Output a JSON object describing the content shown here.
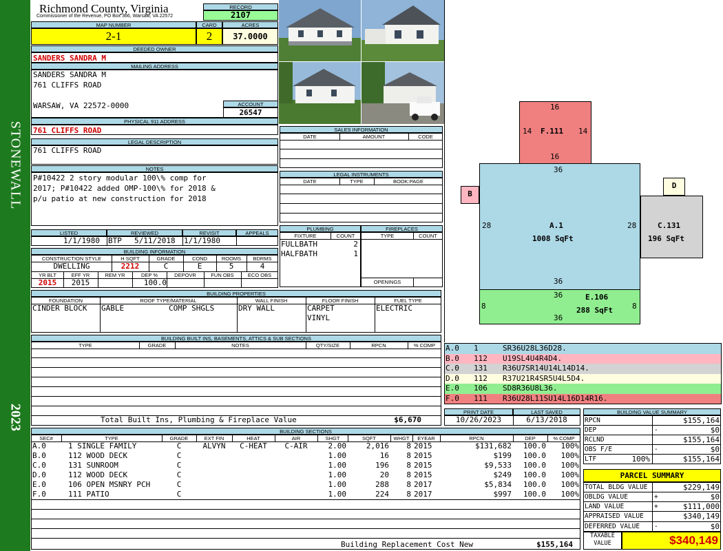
{
  "sidebar": {
    "district": "STONEWALL",
    "year": "2023",
    "color": "#1e7a1e"
  },
  "header": {
    "county": "Richmond County, Virginia",
    "commissioner": "Commissioner of the Revenue, PO Box 366, Warsaw, VA 22572",
    "record_label": "RECORD",
    "record": "2107",
    "map_label": "MAP NUMBER",
    "map": "2-1",
    "card_label": "CARD",
    "card": "2",
    "acres_label": "ACRES",
    "acres": "37.0000"
  },
  "owner": {
    "deeded_label": "DEEDED OWNER",
    "deeded": "SANDERS SANDRA M",
    "mailing_label": "MAILING ADDRESS",
    "line1": "SANDERS SANDRA M",
    "line2": "761 CLIFFS ROAD",
    "line3": "WARSAW, VA 22572-0000",
    "account_label": "ACCOUNT",
    "account": "26547",
    "physical_label": "PHYSICAL 911 ADDRESS",
    "physical": "761 CLIFFS ROAD",
    "legal_label": "LEGAL DESCRIPTION",
    "legal": "761 CLIFFS ROAD"
  },
  "notes": {
    "label": "NOTES",
    "line1": "P#10422 2 story modular 100\\% comp for",
    "line2": "2017; P#10422 added OMP-100\\% for 2018 &",
    "line3": "p/u patio at new construction for 2018"
  },
  "dates": {
    "listed_label": "LISTED",
    "listed": "1/1/1980",
    "reviewed_label": "REVIEWED",
    "reviewed_by": "BTP",
    "reviewed": "5/11/2018",
    "revisit_label": "REVISIT",
    "revisit": "1/1/1980",
    "appeals_label": "APPEALS"
  },
  "building": {
    "label": "BUILDING INFORMATION",
    "cs_label": "CONSTRUCTION STYLE",
    "cs": "DWELLING",
    "hsqft_label": "H SQFT",
    "hsqft": "2212",
    "grade_label": "GRADE",
    "grade": "C",
    "cond_label": "COND",
    "cond": "E",
    "rooms_label": "ROOMS",
    "rooms": "5",
    "bdrms_label": "BDRMS",
    "bdrms": "4",
    "yrblt_label": "YR BLT",
    "yrblt": "2015",
    "effyr_label": "EFF YR",
    "effyr": "2015",
    "remyr_label": "REM YR",
    "dep_label": "DEP %",
    "dep": "100.0",
    "depovr_label": "DEPOVR",
    "funobs_label": "FUN OBS",
    "ecoobs_label": "ECO OBS"
  },
  "sales": {
    "label": "SALES INFORMATION",
    "cols": [
      "DATE",
      "AMOUNT",
      "CODE"
    ]
  },
  "legal_instr": {
    "label": "LEGAL INSTRUMENTS",
    "cols": [
      "DATE",
      "TYPE",
      "BOOK:PAGE"
    ]
  },
  "plumbing": {
    "label": "PLUMBING",
    "fixture_label": "FIXTURE",
    "count_label": "COUNT",
    "rows": [
      {
        "f": "FULLBATH",
        "c": "2"
      },
      {
        "f": "HALFBATH",
        "c": "1"
      }
    ]
  },
  "fireplaces": {
    "label": "FIREPLACES",
    "type_label": "TYPE",
    "count_label": "COUNT",
    "openings_label": "OPENINGS"
  },
  "properties": {
    "label": "BUILDING PROPERTIES",
    "foundation_label": "FOUNDATION",
    "foundation": "CINDER BLOCK",
    "roof_label": "ROOF TYPE/MATERIAL",
    "roof1": "GABLE",
    "roof2": "COMP SHGLS",
    "wall_label": "WALL FINISH",
    "wall": "DRY WALL",
    "floor_label": "FLOOR FINISH",
    "floor1": "CARPET",
    "floor2": "VINYL",
    "fuel_label": "FUEL TYPE",
    "fuel": "ELECTRIC"
  },
  "builtins": {
    "label": "BUILDING BUILT INS, BASEMENTS, ATTICS & SUB SECTIONS",
    "cols": [
      "TYPE",
      "GRADE",
      "NOTES",
      "QTY/SIZE",
      "RPCN",
      "% COMP"
    ],
    "total_label": "Total Built Ins, Plumbing & Fireplace Value",
    "total": "$6,670"
  },
  "sections": {
    "label": "BUILDING SECTIONS",
    "cols": [
      "SEC#",
      "TYPE",
      "GRADE",
      "EXT FIN",
      "HEAT",
      "AIR",
      "SHGT",
      "SQFT",
      "WHGT",
      "EYEAR",
      "RPCN",
      "DEP",
      "% COMP"
    ],
    "rows": [
      [
        "A.0",
        "1 SINGLE FAMILY",
        "C",
        "ALVYN",
        "C-HEAT",
        "C-AIR",
        "2.00",
        "2,016",
        "8",
        "2015",
        "$131,682",
        "100.0",
        "100%"
      ],
      [
        "B.0",
        "112 WOOD DECK",
        "C",
        "",
        "",
        "",
        "1.00",
        "16",
        "8",
        "2015",
        "$199",
        "100.0",
        "100%"
      ],
      [
        "C.0",
        "131 SUNROOM",
        "C",
        "",
        "",
        "",
        "1.00",
        "196",
        "8",
        "2015",
        "$9,533",
        "100.0",
        "100%"
      ],
      [
        "D.0",
        "112 WOOD DECK",
        "C",
        "",
        "",
        "",
        "1.00",
        "20",
        "8",
        "2015",
        "$249",
        "100.0",
        "100%"
      ],
      [
        "E.0",
        "106 OPEN MSNRY PCH",
        "C",
        "",
        "",
        "",
        "1.00",
        "288",
        "8",
        "2017",
        "$5,834",
        "100.0",
        "100%"
      ],
      [
        "F.0",
        "111 PATIO",
        "C",
        "",
        "",
        "",
        "1.00",
        "224",
        "8",
        "2017",
        "$997",
        "100.0",
        "100%"
      ]
    ],
    "total_label": "Building Replacement Cost New",
    "total": "$155,164"
  },
  "sketch": {
    "F": {
      "label": "F.111",
      "top": "16",
      "bottom": "16",
      "left": "14",
      "right": "14",
      "color": "#f08080"
    },
    "A": {
      "label": "A.1",
      "area": "1008 SqFt",
      "top": "36",
      "bottom": "36",
      "left": "28",
      "right": "28",
      "color": "#add8e6"
    },
    "B": {
      "label": "B",
      "color": "#ffb6c1"
    },
    "C": {
      "label": "C.131",
      "area": "196 SqFt",
      "color": "#d3d3d3"
    },
    "D": {
      "label": "D",
      "color": "#fffde0"
    },
    "E": {
      "label": "E.106",
      "area": "288 SqFt",
      "top": "36",
      "bottom": "36",
      "left": "8",
      "right": "8",
      "color": "#90ee90"
    }
  },
  "legend": [
    {
      "sec": "A.0",
      "code": "1",
      "path": "SR36U28L36D28.",
      "color": "#add8e6"
    },
    {
      "sec": "B.0",
      "code": "112",
      "path": "U19SL4U4R4D4.",
      "color": "#ffb6c1"
    },
    {
      "sec": "C.0",
      "code": "131",
      "path": "R36U7SR14U14L14D14.",
      "color": "#d3d3d3"
    },
    {
      "sec": "D.0",
      "code": "112",
      "path": "R37U21R4SR5U4L5D4.",
      "color": "#fffde0"
    },
    {
      "sec": "E.0",
      "code": "106",
      "path": "SD8R36U8L36.",
      "color": "#90ee90"
    },
    {
      "sec": "F.0",
      "code": "111",
      "path": "R36U28L11SU14L16D14R16.",
      "color": "#f08080"
    }
  ],
  "print": {
    "print_label": "PRINT DATE",
    "print": "10/26/2023",
    "saved_label": "LAST SAVED",
    "saved": "6/13/2018"
  },
  "bvs": {
    "label": "BUILDING VALUE SUMMARY",
    "rpcn_label": "RPCN",
    "rpcn": "$155,164",
    "dep_label": "DEP",
    "dep_sign": "-",
    "dep": "$0",
    "rclnd_label": "RCLND",
    "rclnd": "$155,164",
    "obs_label": "OBS F/E",
    "obs_sign": "-",
    "obs": "$0",
    "ltf_label": "LTF",
    "ltf_pct": "100%",
    "ltf": "$155,164"
  },
  "parcel": {
    "label": "PARCEL SUMMARY",
    "tbv_label": "TOTAL BLDG VALUE",
    "tbv": "$229,149",
    "obldg_label": "OBLDG VALUE",
    "obldg_sign": "+",
    "obldg": "$0",
    "land_label": "LAND VALUE",
    "land_sign": "+",
    "land": "$111,000",
    "appr_label": "APPRAISED VALUE",
    "appr": "$340,149",
    "def_label": "DEFERRED VALUE",
    "def_sign": "-",
    "def": "$0",
    "taxable_label1": "TAXABLE",
    "taxable_label2": "VALUE",
    "taxable": "$340,149"
  }
}
